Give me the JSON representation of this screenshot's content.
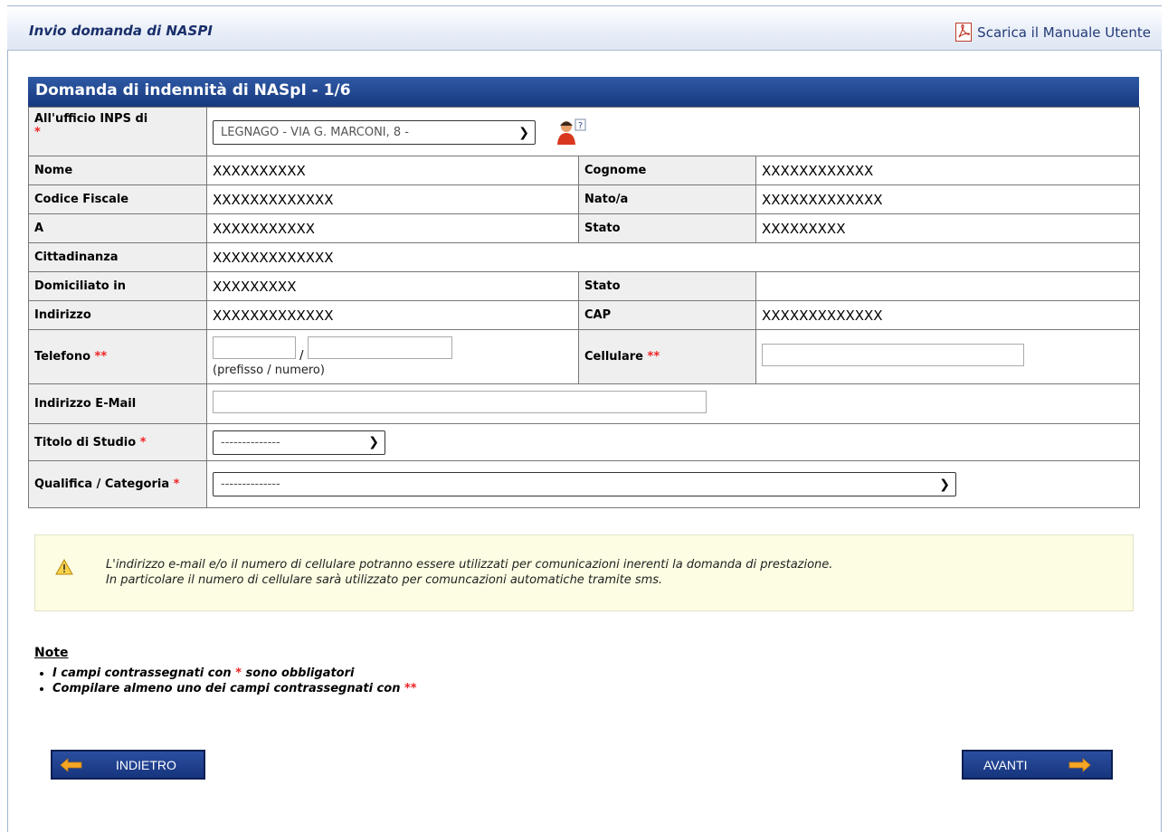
{
  "header": {
    "title": "Invio domanda di NASPI",
    "manual_link": "Scarica il Manuale Utente"
  },
  "form": {
    "title": "Domanda di indennità di NASpI - 1/6",
    "ufficio": {
      "label": "All'ufficio INPS di",
      "value": "LEGNAGO - VIA G. MARCONI, 8 -"
    },
    "nome": {
      "label": "Nome",
      "value": "XXXXXXXXXX"
    },
    "cognome": {
      "label": "Cognome",
      "value": "XXXXXXXXXXXX"
    },
    "codice_fiscale": {
      "label": "Codice Fiscale",
      "value": "XXXXXXXXXXXXX"
    },
    "nato": {
      "label": "Nato/a",
      "value": "XXXXXXXXXXXXX"
    },
    "a": {
      "label": "A",
      "value": "XXXXXXXXXXX"
    },
    "stato1": {
      "label": "Stato",
      "value": "XXXXXXXXX"
    },
    "cittadinanza": {
      "label": "Cittadinanza",
      "value": "XXXXXXXXXXXXX"
    },
    "domiciliato": {
      "label": "Domiciliato in",
      "value": "XXXXXXXXX"
    },
    "stato2": {
      "label": "Stato",
      "value": ""
    },
    "indirizzo": {
      "label": "Indirizzo",
      "value": "XXXXXXXXXXXXX"
    },
    "cap": {
      "label": "CAP",
      "value": "XXXXXXXXXXXXX"
    },
    "telefono": {
      "label": "Telefono",
      "req": "**",
      "sep": "/",
      "hint": "(prefisso / numero)",
      "prefisso": "",
      "numero": ""
    },
    "cellulare": {
      "label": "Cellulare",
      "req": "**",
      "value": ""
    },
    "email": {
      "label": "Indirizzo E-Mail",
      "value": ""
    },
    "titolo_studio": {
      "label": "Titolo di Studio",
      "req": "*",
      "value": "--------------"
    },
    "qualifica": {
      "label": "Qualifica / Categoria",
      "req": "*",
      "value": "--------------"
    },
    "ufficio_req": "*"
  },
  "warning": {
    "line1": "L'indirizzo e-mail e/o il numero di cellulare potranno essere utilizzati per comunicazioni inerenti la domanda di prestazione.",
    "line2": "In particolare il numero di cellulare sarà utilizzato per comuncazioni automatiche tramite sms."
  },
  "notes": {
    "heading": "Note",
    "item1_pre": "I campi contrassegnati con ",
    "item1_star": "*",
    "item1_post": " sono obbligatori",
    "item2_pre": "Compilare almeno uno dei campi contrassegnati con ",
    "item2_star": "**"
  },
  "buttons": {
    "back": "INDIETRO",
    "next": "AVANTI"
  },
  "colors": {
    "accent": "#17387e",
    "required": "#e22222",
    "warning_bg": "#fdfde3"
  }
}
